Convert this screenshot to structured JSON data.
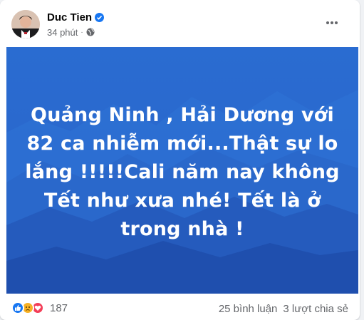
{
  "post": {
    "author": "Duc Tien",
    "time": "34 phút",
    "separator": "·",
    "text_lines": [
      "Quảng Ninh , Hải Dương với",
      "82 ca nhiễm mới...Thật sự lo",
      "lắng !!!!!Cali năm nay không",
      "Tết như xưa nhé! Tết là ở",
      "trong nhà !"
    ],
    "reaction_count": "187",
    "comments": "25 bình luận",
    "shares": "3 lượt chia sẻ"
  },
  "icons": {
    "verified": "verified-badge-icon",
    "privacy": "globe-icon",
    "more": "more-horizontal-icon",
    "reactions": [
      "like-icon",
      "sad-icon",
      "love-icon"
    ]
  },
  "colors": {
    "image_background": "#2f6fcf",
    "verified": "#1877f2",
    "like": "#1877f2",
    "love": "#f33e58",
    "sad": "#f7b125",
    "secondary_text": "#65676b"
  }
}
